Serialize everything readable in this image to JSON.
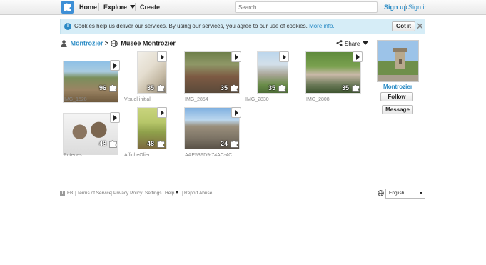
{
  "nav": {
    "home": "Home",
    "explore": "Explore",
    "create": "Create",
    "search_placeholder": "Search...",
    "signup": "Sign up",
    "signin": "Sign in"
  },
  "cookie": {
    "message": "Cookies help us deliver our services. By using our services, you agree to our use of cookies.",
    "more_info": "More info.",
    "got_it": "Got it",
    "close": "✕"
  },
  "breadcrumb": {
    "owner": "Montrozier",
    "separator": ">",
    "album": "Musée Montrozier"
  },
  "share": "Share",
  "puzzles": [
    {
      "caption": "IMG_1528",
      "count": "96"
    },
    {
      "caption": "Visuel initial",
      "count": "35"
    },
    {
      "caption": "IMG_2854",
      "count": "35"
    },
    {
      "caption": "IMG_2830",
      "count": "35"
    },
    {
      "caption": "IMG_2808",
      "count": "35"
    },
    {
      "caption": "Poteries",
      "count": "48"
    },
    {
      "caption": "AfficheOlier",
      "count": "48"
    },
    {
      "caption": "AAE53FD9-74AC-4C...",
      "count": "24"
    }
  ],
  "profile": {
    "name": "Montrozier",
    "follow": "Follow",
    "message": "Message"
  },
  "footer": {
    "fb": "FB",
    "links": [
      "Terms of Service",
      "Privacy Policy",
      "Settings",
      "Help",
      "Report Abuse"
    ],
    "language": "English"
  },
  "colors": {
    "accent": "#2a8bc5",
    "cookie_bg": "#d6edf7"
  }
}
